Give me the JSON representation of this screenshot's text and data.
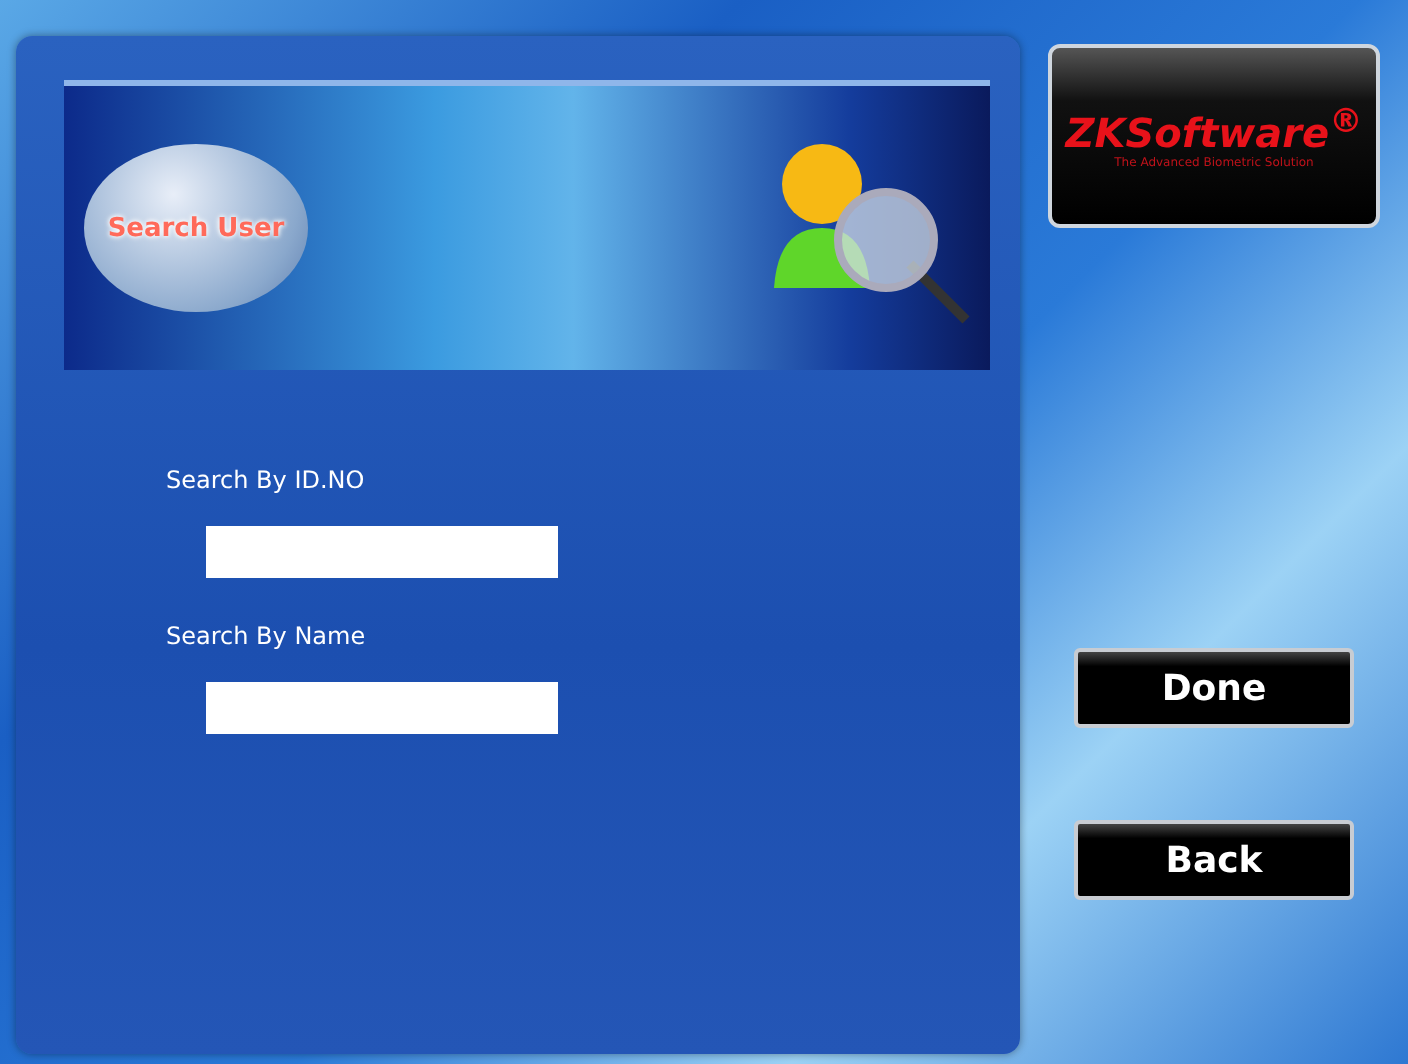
{
  "header": {
    "title": "Search User"
  },
  "logo": {
    "brand": "ZKSoftware",
    "mark": "®",
    "tagline": "The Advanced Biometric Solution"
  },
  "fields": [
    {
      "label": "Search By ID.NO"
    },
    {
      "label": "Search By Name"
    }
  ],
  "buttons": [
    "Done",
    "Back"
  ]
}
